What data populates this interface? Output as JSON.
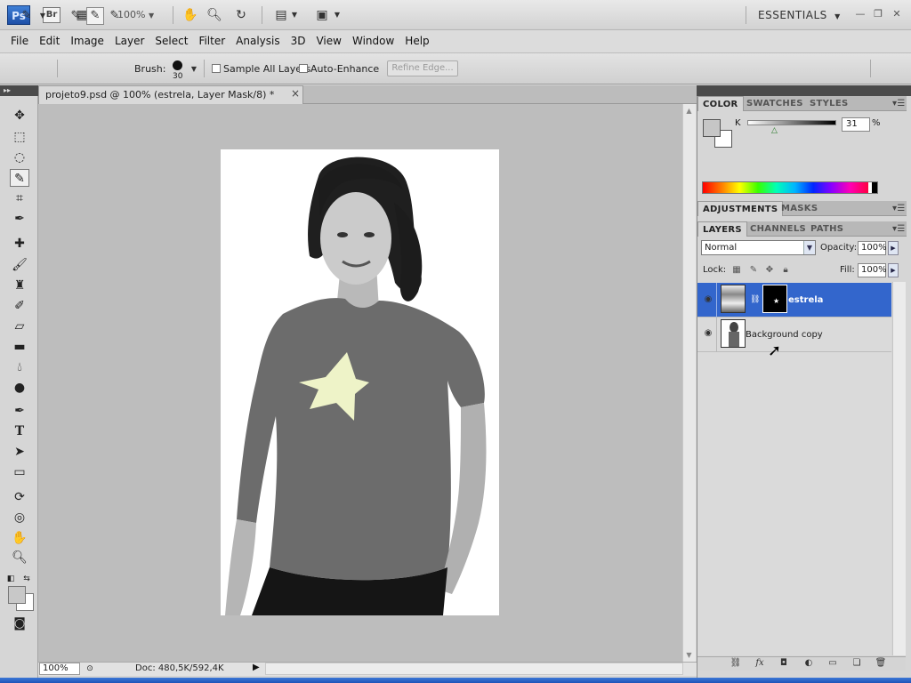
{
  "appbar": {
    "ps_logo": "Ps",
    "br_logo": "Br",
    "zoom": "100%",
    "workspace": "ESSENTIALS",
    "icons": [
      "mini-bridge-icon",
      "hand-tool-icon",
      "zoom-tool-icon",
      "rotate-view-icon",
      "arrange-docs-icon",
      "screen-mode-icon"
    ]
  },
  "menu": [
    "File",
    "Edit",
    "Image",
    "Layer",
    "Select",
    "Filter",
    "Analysis",
    "3D",
    "View",
    "Window",
    "Help"
  ],
  "options": {
    "brush_label": "Brush:",
    "brush_size": "30",
    "sample_all_layers": "Sample All Layers",
    "auto_enhance": "Auto-Enhance",
    "refine_edge": "Refine Edge..."
  },
  "document": {
    "tab_title": "projeto9.psd @ 100% (estrela, Layer Mask/8) *",
    "close": "×",
    "zoom": "100%",
    "doc_info": "Doc: 480,5K/592,4K"
  },
  "panels": {
    "color_tabs": [
      "COLOR",
      "SWATCHES",
      "STYLES"
    ],
    "color_k_label": "K",
    "color_k_value": "31",
    "color_k_unit": "%",
    "adjust_tabs": [
      "ADJUSTMENTS",
      "MASKS"
    ],
    "layer_tabs": [
      "LAYERS",
      "CHANNELS",
      "PATHS"
    ],
    "blend_mode": "Normal",
    "opacity_label": "Opacity:",
    "opacity_value": "100%",
    "lock_label": "Lock:",
    "fill_label": "Fill:",
    "fill_value": "100%",
    "layers": [
      {
        "name": "estrela",
        "selected": true
      },
      {
        "name": "Background copy",
        "selected": false
      }
    ]
  },
  "colors": {
    "selected_layer": "#3366cc",
    "star": "#eef3c8",
    "shirt": "#6c6c6c"
  }
}
